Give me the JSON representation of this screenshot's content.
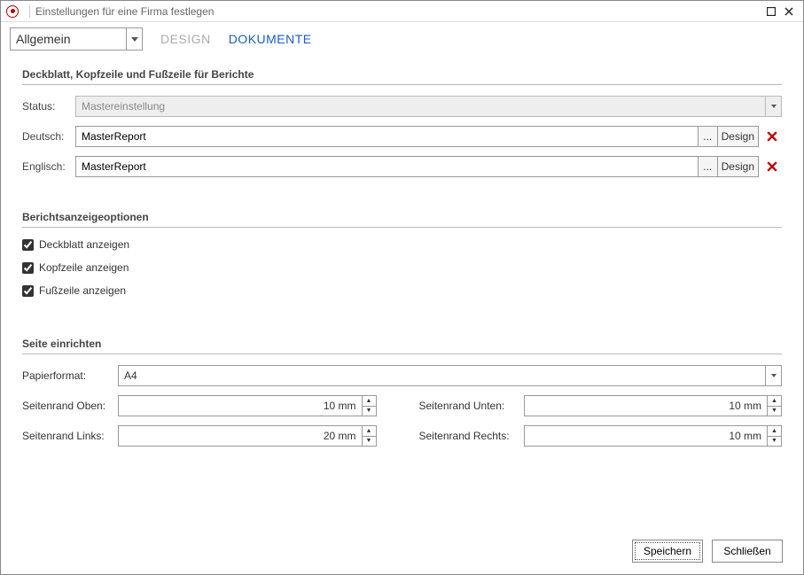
{
  "window": {
    "title": "Einstellungen für eine Firma festlegen"
  },
  "topbar": {
    "scope": "Allgemein",
    "tabs": {
      "design": "DESIGN",
      "dokumente": "DOKUMENTE"
    }
  },
  "section1": {
    "title": "Deckblatt, Kopfzeile und Fußzeile für Berichte",
    "status_label": "Status:",
    "status_value": "Mastereinstellung",
    "deutsch_label": "Deutsch:",
    "deutsch_value": "MasterReport",
    "englisch_label": "Englisch:",
    "englisch_value": "MasterReport",
    "ellipsis": "...",
    "design_btn": "Design"
  },
  "section2": {
    "title": "Berichtsanzeigeoptionen",
    "deckblatt": "Deckblatt anzeigen",
    "kopfzeile": "Kopfzeile anzeigen",
    "fusszeile": "Fußzeile anzeigen"
  },
  "section3": {
    "title": "Seite einrichten",
    "papierformat_label": "Papierformat:",
    "papierformat_value": "A4",
    "oben_label": "Seitenrand Oben:",
    "oben_value": "10 mm",
    "unten_label": "Seitenrand Unten:",
    "unten_value": "10 mm",
    "links_label": "Seitenrand Links:",
    "links_value": "20 mm",
    "rechts_label": "Seitenrand Rechts:",
    "rechts_value": "10 mm"
  },
  "footer": {
    "save": "Speichern",
    "close": "Schließen"
  }
}
